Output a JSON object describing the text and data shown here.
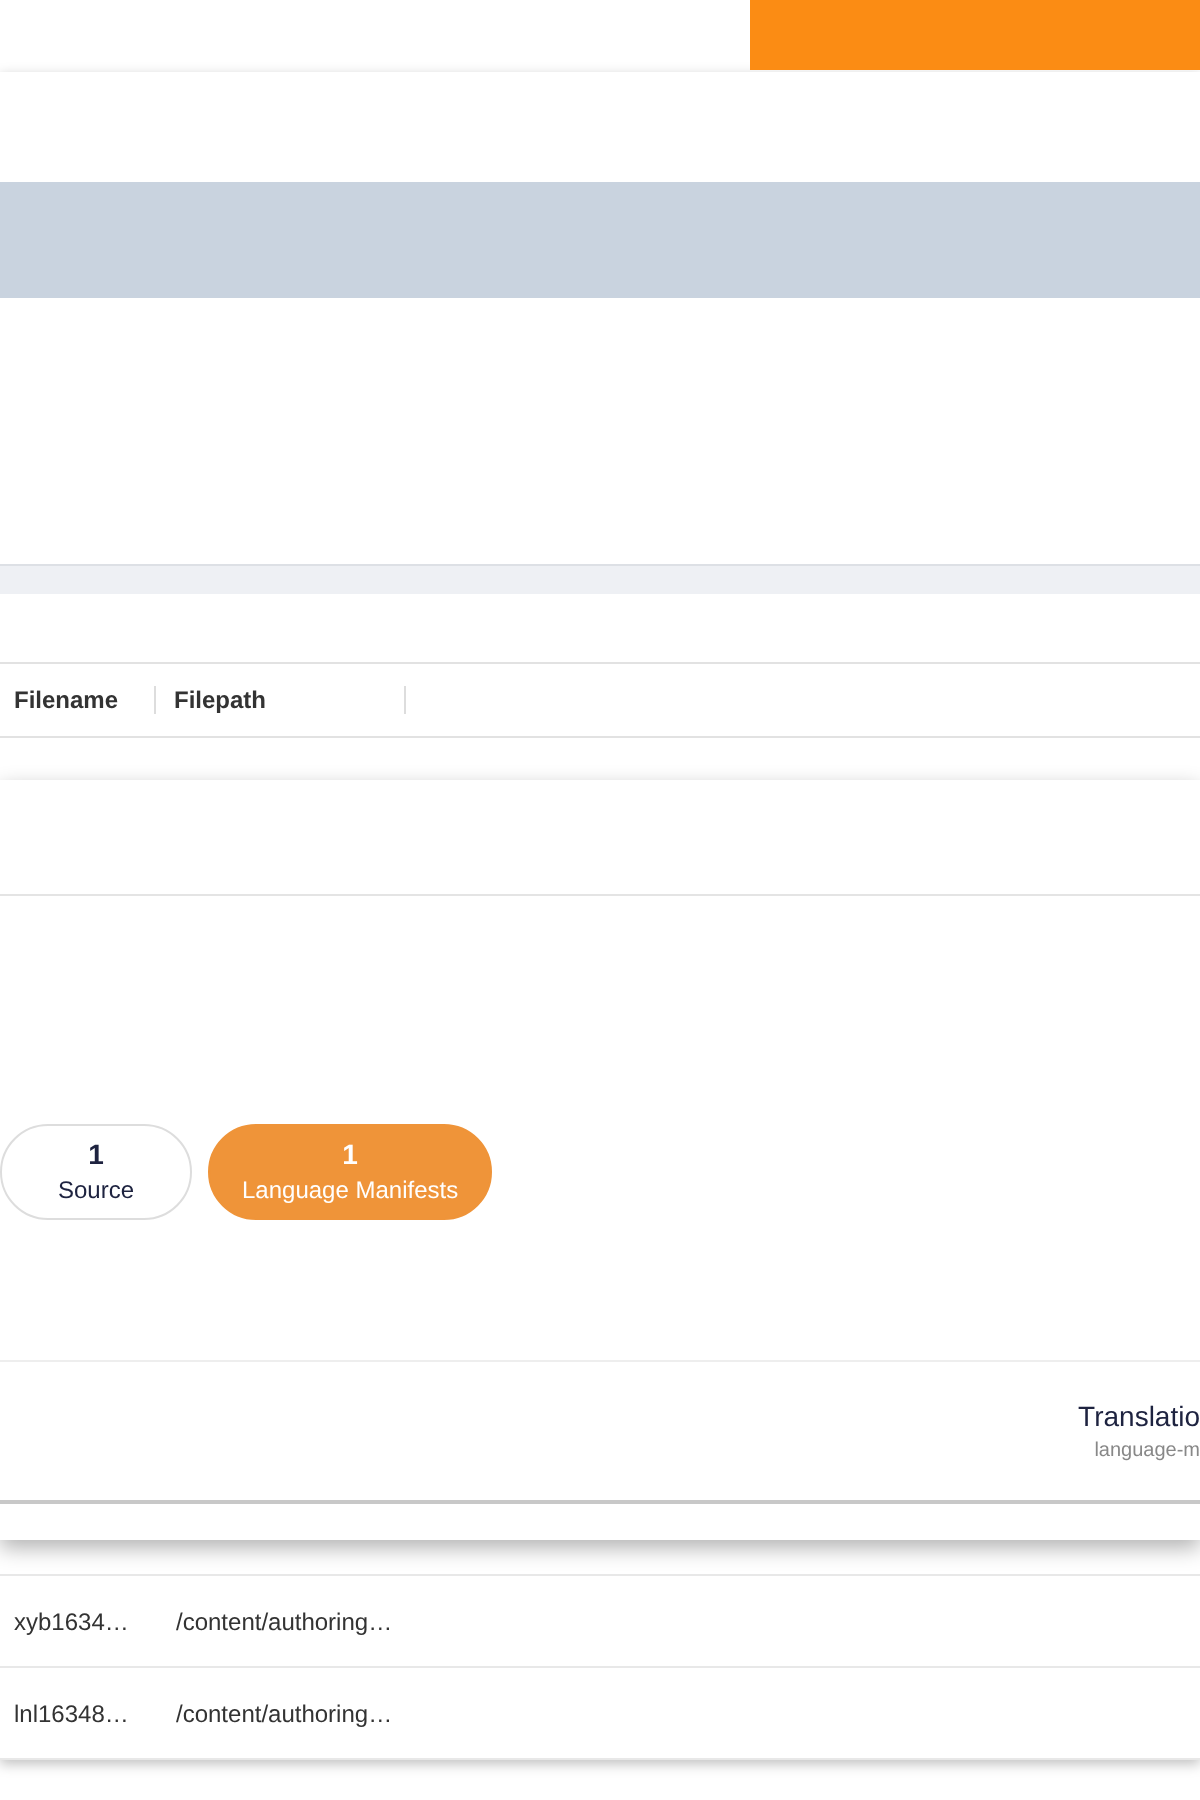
{
  "table": {
    "columns": [
      "Filename",
      "Filepath"
    ],
    "rows": [
      {
        "filename": "xyb1634…",
        "filepath": "/content/authoring…"
      },
      {
        "filename": "lnl16348…",
        "filepath": "/content/authoring…"
      }
    ]
  },
  "panel": {
    "pills": [
      {
        "count": "1",
        "label": "Source",
        "selected": false
      },
      {
        "count": "1",
        "label": "Language Manifests",
        "selected": true
      }
    ],
    "row": {
      "title": "Translatio",
      "subtitle": "language-m"
    }
  }
}
